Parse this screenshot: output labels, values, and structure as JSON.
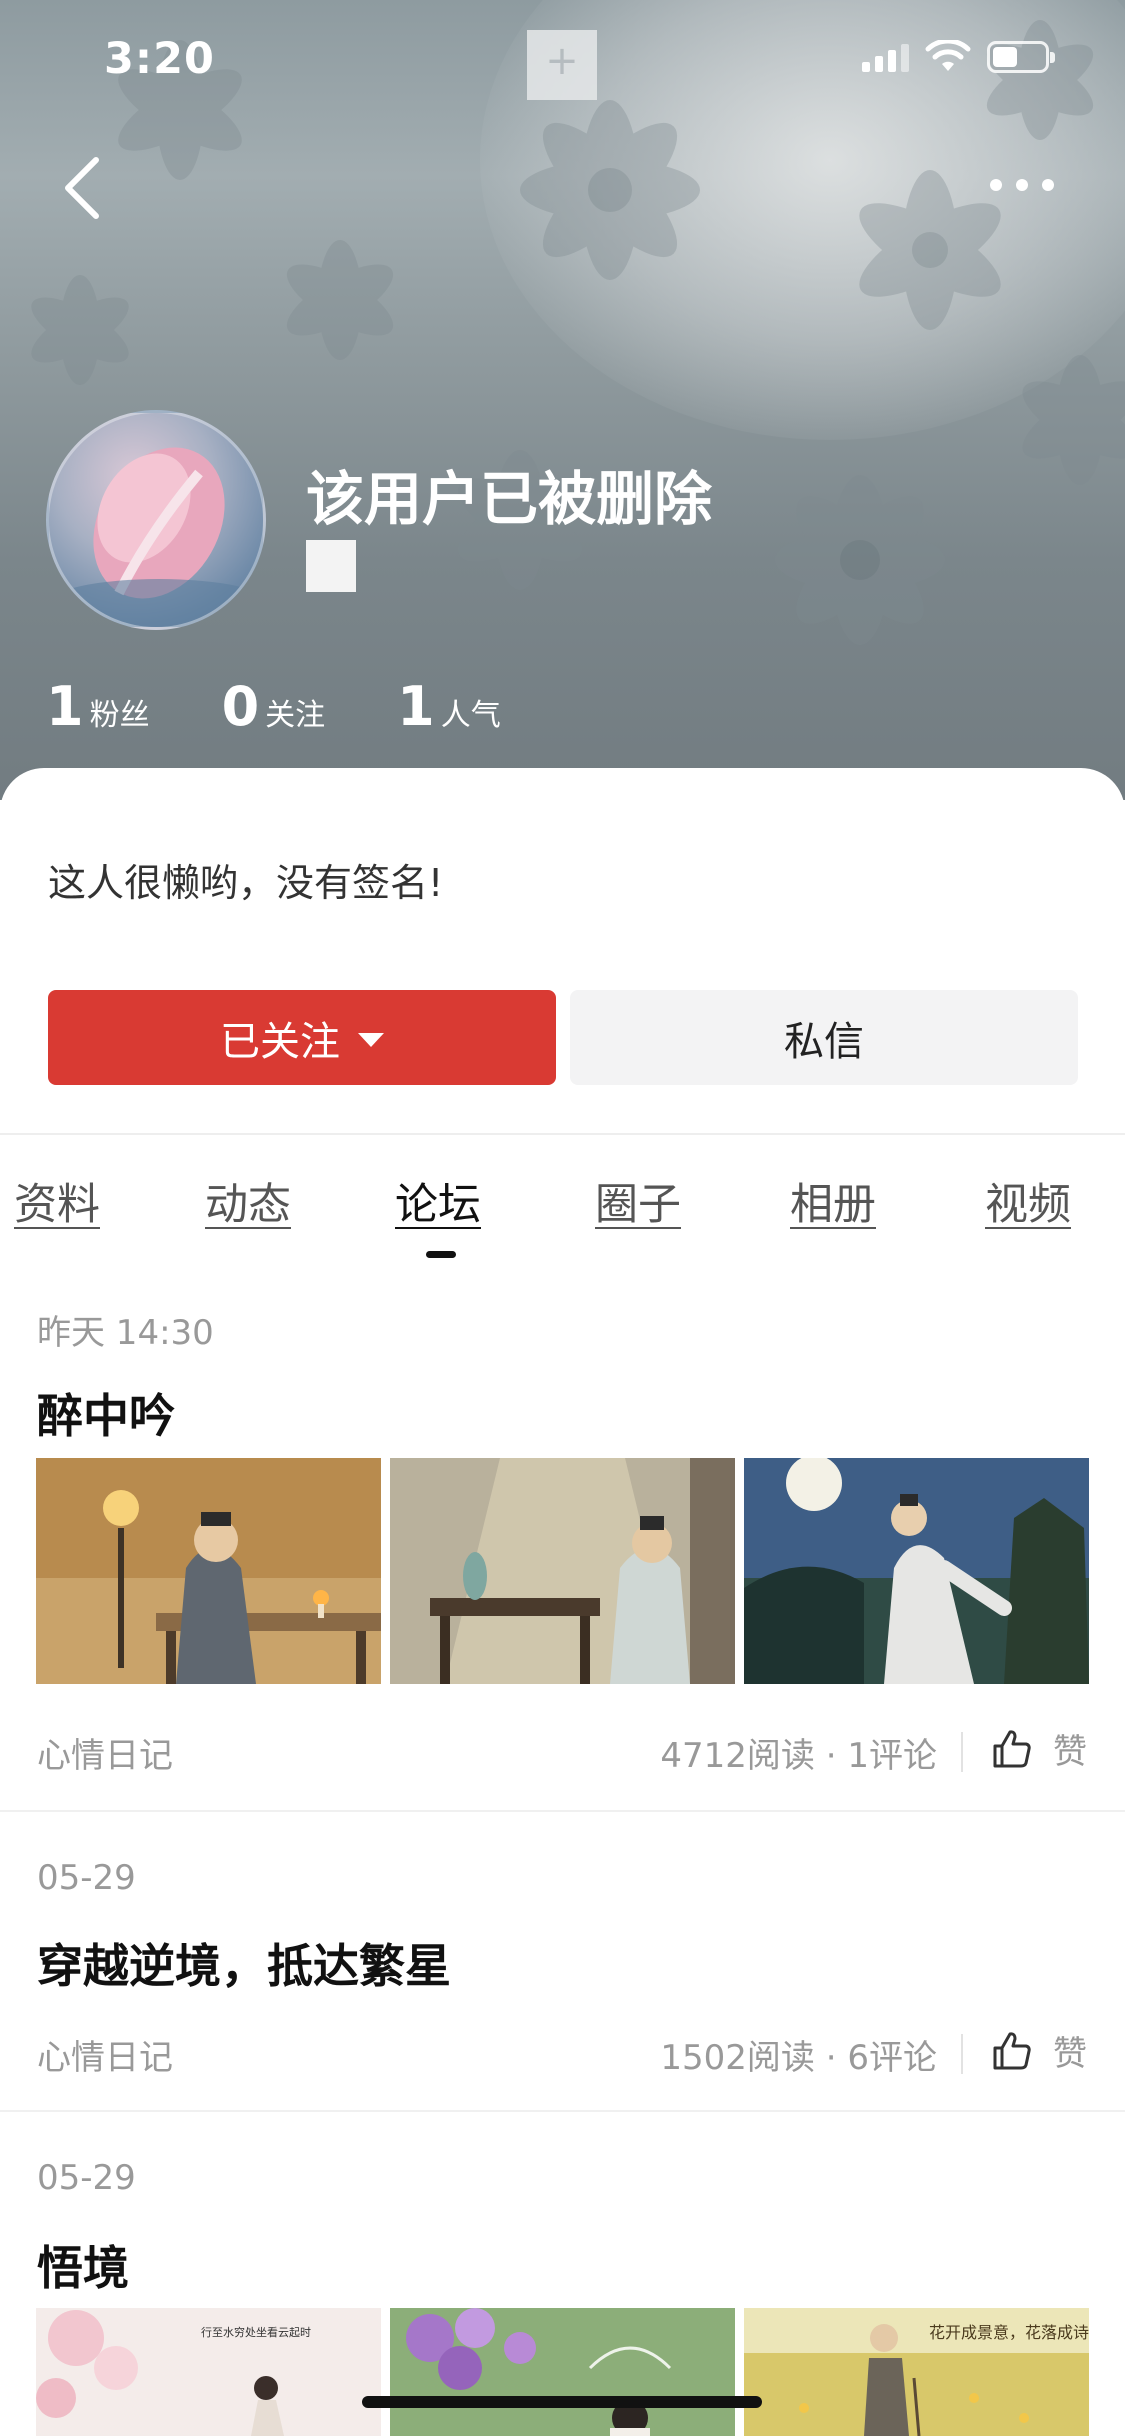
{
  "status_bar": {
    "time": "3:20"
  },
  "profile": {
    "username": "该用户已被删除",
    "signature": "这人很懒哟，没有签名!",
    "stats": [
      {
        "value": "1",
        "label": "粉丝"
      },
      {
        "value": "0",
        "label": "关注"
      },
      {
        "value": "1",
        "label": "人气"
      }
    ]
  },
  "actions": {
    "follow_label": "已关注",
    "message_label": "私信"
  },
  "tabs": [
    {
      "label": "资料"
    },
    {
      "label": "动态"
    },
    {
      "label": "论坛",
      "active": true
    },
    {
      "label": "圈子"
    },
    {
      "label": "相册"
    },
    {
      "label": "视频"
    }
  ],
  "posts": [
    {
      "date": "昨天 14:30",
      "title": "醉中吟",
      "category": "心情日记",
      "stats": "4712阅读 · 1评论",
      "like_label": "赞",
      "has_images": true
    },
    {
      "date": "05-29",
      "title": "穿越逆境，抵达繁星",
      "category": "心情日记",
      "stats": "1502阅读 · 6评论",
      "like_label": "赞",
      "has_images": false
    },
    {
      "date": "05-29",
      "title": "悟境",
      "has_images": true,
      "image_captions": [
        "行至水穷处坐看云起时",
        "花开成景意，花落成诗"
      ]
    }
  ],
  "colors": {
    "accent": "#d93a33",
    "header_bg": "#8e9ba0"
  },
  "icons": [
    "back-icon",
    "more-icon",
    "signal-icon",
    "wifi-icon",
    "battery-icon",
    "thumb-up-icon",
    "caret-down-icon"
  ]
}
